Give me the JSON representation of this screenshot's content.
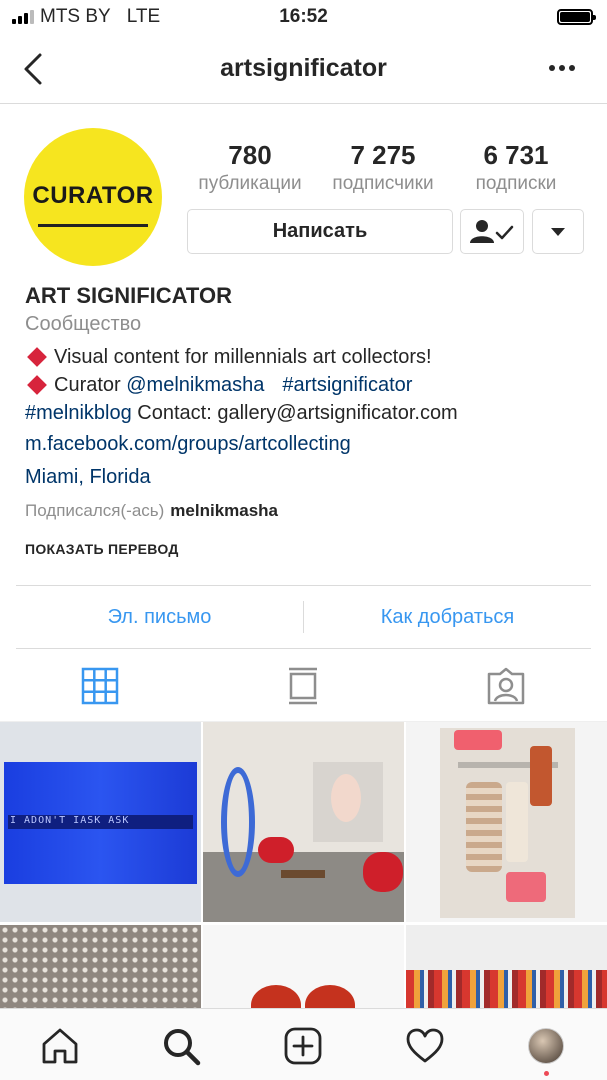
{
  "status_bar": {
    "carrier": "MTS BY",
    "network": "LTE",
    "time": "16:52"
  },
  "header": {
    "username": "artsignificator"
  },
  "profile": {
    "avatar_text": "CURATOR",
    "stats": [
      {
        "value": "780",
        "label": "публикации"
      },
      {
        "value": "7 275",
        "label": "подписчики"
      },
      {
        "value": "6 731",
        "label": "подписки"
      }
    ],
    "message_button": "Написать"
  },
  "bio": {
    "name": "ART SIGNIFICATOR",
    "category": "Сообщество",
    "line1": "Visual content for millennials art collectors!",
    "line2_prefix": "Curator ",
    "line2_mention": "@melnikmasha",
    "line2_hashtag": "#artsignificator",
    "line3_hashtag": "#melnikblog",
    "line3_text": " Contact: gallery@artsignificator.com",
    "url": "m.facebook.com/groups/artcollecting",
    "location": "Miami, Florida",
    "followed_by_label": "Подписался(-ась)",
    "followed_by_user": "melnikmasha",
    "translate_label": "ПОКАЗАТЬ ПЕРЕВОД"
  },
  "contact": {
    "email_label": "Эл. письмо",
    "directions_label": "Как добраться"
  },
  "posts": {
    "post1_text": "I ADON'T IASK ASK"
  },
  "colors": {
    "link": "#003569",
    "accent": "#3897f0",
    "muted": "#8e8e8e",
    "notification": "#ed4956"
  }
}
